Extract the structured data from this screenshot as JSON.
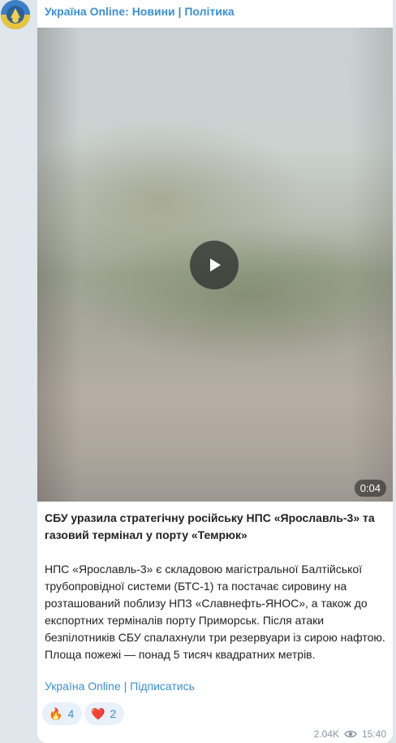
{
  "channel": {
    "name": "Україна Online: Новини | Політика"
  },
  "video": {
    "duration": "0:04"
  },
  "post": {
    "headline": "СБУ уразила стратегічну російську НПС «Ярославль-3» та газовий термінал у порту «Темрюк»",
    "body": "НПС «Ярославль-3» є складовою магістральної Балтійської трубопровідної системи (БТС-1) та постачає сировину на розташований поблизу НПЗ «Славнефть-ЯНОС», а також до експортних терміналів порту Приморськ. Після атаки безпілотників СБУ спалахнули три резервуари із сирою нафтою. Площа пожежі — понад 5 тисяч квадратних метрів.",
    "subscribe_link": "Україна Online | Підписатись"
  },
  "reactions": [
    {
      "icon": "fire-icon",
      "emoji": "🔥",
      "count": "4"
    },
    {
      "icon": "heart-icon",
      "emoji": "❤️",
      "count": "2"
    }
  ],
  "meta": {
    "views": "2.04K",
    "time": "15:40"
  },
  "colors": {
    "accent": "#3a8fd8",
    "bubble": "#ffffff",
    "background": "#dfe6ec"
  }
}
